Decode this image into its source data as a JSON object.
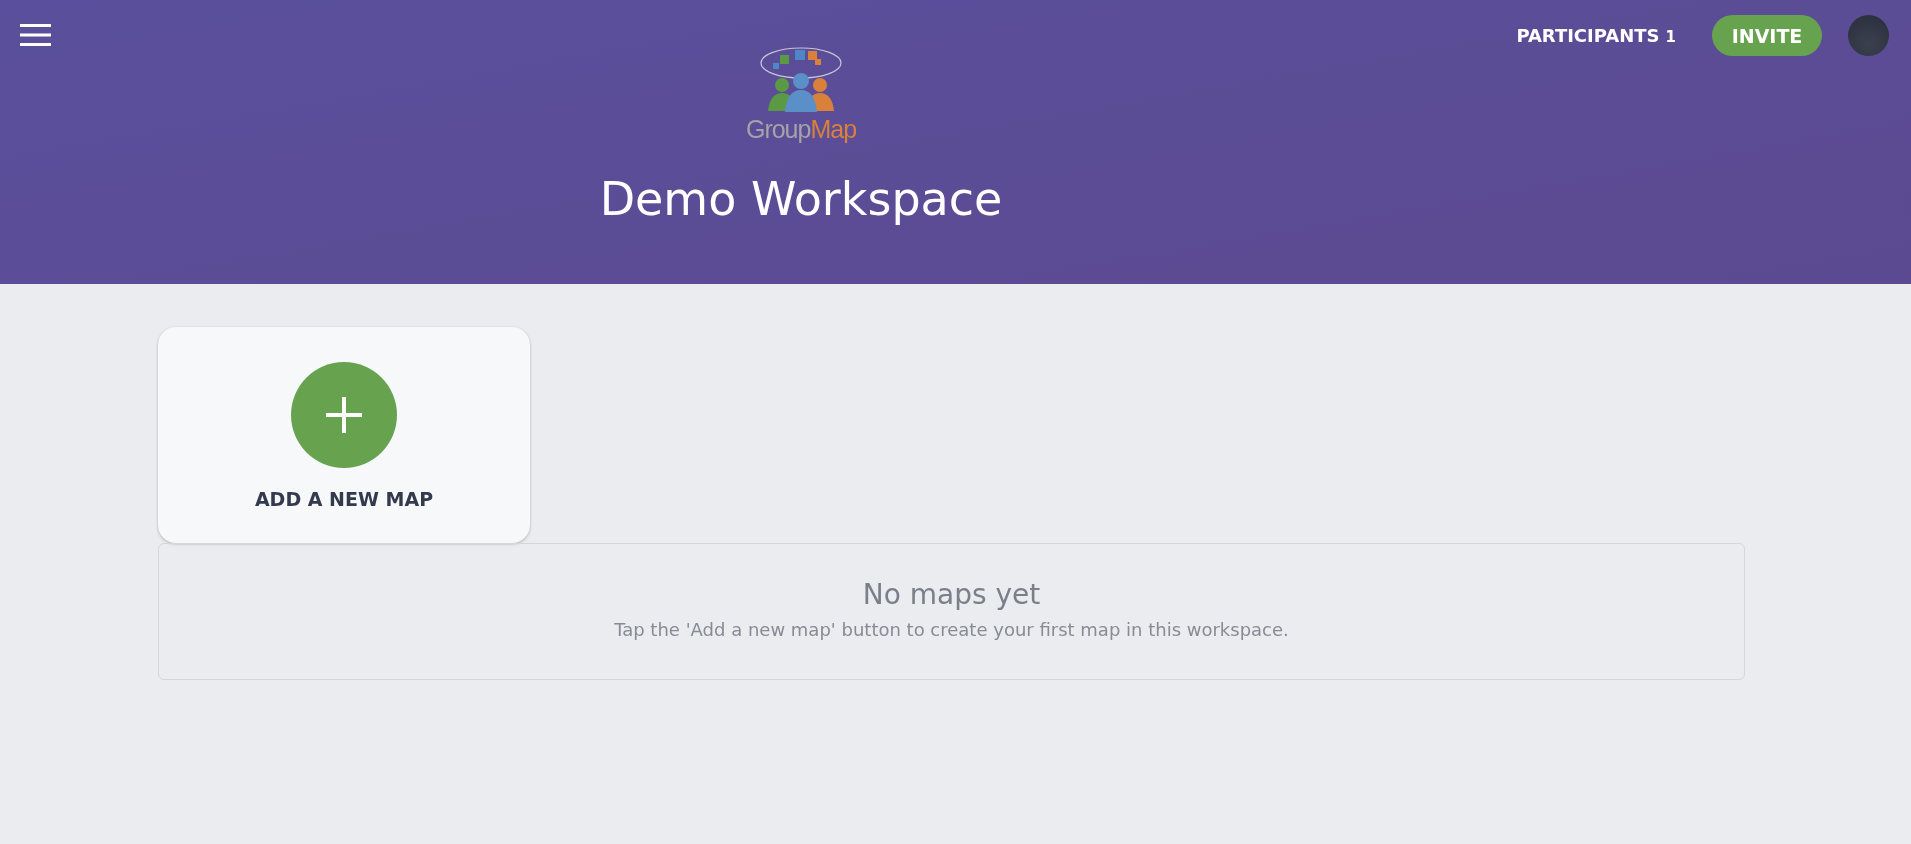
{
  "header": {
    "logo": {
      "parts": [
        {
          "text": "Group",
          "color": "#a3a3a8"
        },
        {
          "text": "Map",
          "color": "#d9803a"
        }
      ]
    },
    "title": "Demo Workspace",
    "participants": {
      "label": "PARTICIPANTS",
      "count": "1"
    },
    "invite_button": "INVITE"
  },
  "add_card": {
    "label": "ADD A NEW MAP"
  },
  "empty_state": {
    "title": "No maps yet",
    "message": "Tap the 'Add a new map' button to create your first map in this workspace."
  }
}
